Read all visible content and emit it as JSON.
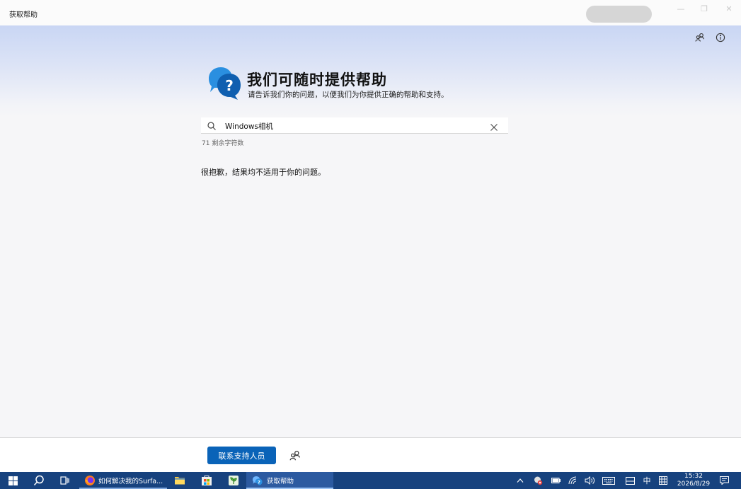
{
  "window": {
    "title": "获取帮助",
    "controls": {
      "minimize": "—",
      "restore": "❐",
      "close": "✕"
    }
  },
  "header": {
    "headline": "我们可随时提供帮助",
    "subline": "请告诉我们你的问题，以便我们为你提供正确的帮助和支持。",
    "icons": [
      "community-icon",
      "info-icon"
    ]
  },
  "search": {
    "value": "Windows相机",
    "char_count": "71 剩余字符数"
  },
  "results": {
    "message": "很抱歉，结果均不适用于你的问题。"
  },
  "footer": {
    "contact_label": "联系支持人员"
  },
  "taskbar": {
    "apps": [
      {
        "name": "firefox",
        "label": "如何解决我的Surfa..."
      },
      {
        "name": "file-explorer",
        "label": ""
      },
      {
        "name": "store",
        "label": ""
      },
      {
        "name": "app-green",
        "label": ""
      },
      {
        "name": "get-help",
        "label": "获取帮助"
      }
    ],
    "tray": {
      "ime_lang": "中",
      "time": "15:32",
      "date": "2026/8/29"
    },
    "colors": {
      "bg": "#17427e",
      "active": "#2c5aa0"
    }
  },
  "colors": {
    "accent": "#0a63b8",
    "hero_top": "#c9d6f4"
  }
}
